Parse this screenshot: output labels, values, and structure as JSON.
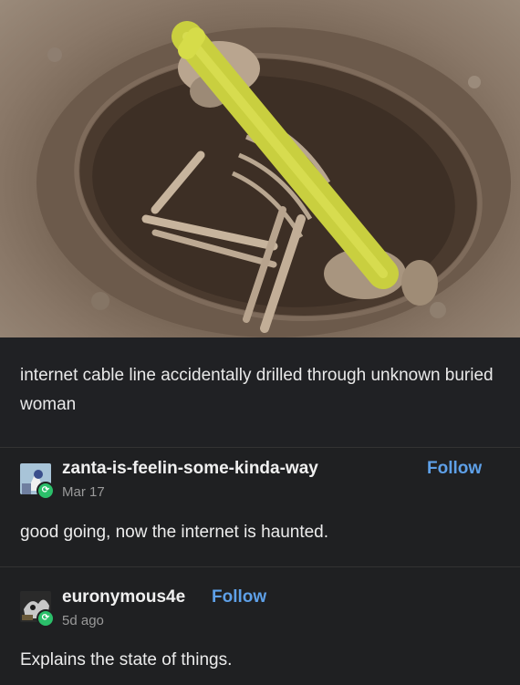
{
  "post": {
    "caption": "internet cable line accidentally drilled through unknown buried woman"
  },
  "reblogs": [
    {
      "username": "zanta-is-feelin-some-kinda-way",
      "date": "Mar 17",
      "follow_label": "Follow",
      "text": "good going, now the internet is haunted."
    },
    {
      "username": "euronymous4e",
      "date": "5d ago",
      "follow_label": "Follow",
      "text": "Explains the state of things."
    }
  ],
  "colors": {
    "follow": "#5ea0e8",
    "reblog_badge": "#2bbf6a",
    "cable": "#c9cf3f"
  },
  "icons": {
    "reblog_badge": "reblog-icon"
  }
}
